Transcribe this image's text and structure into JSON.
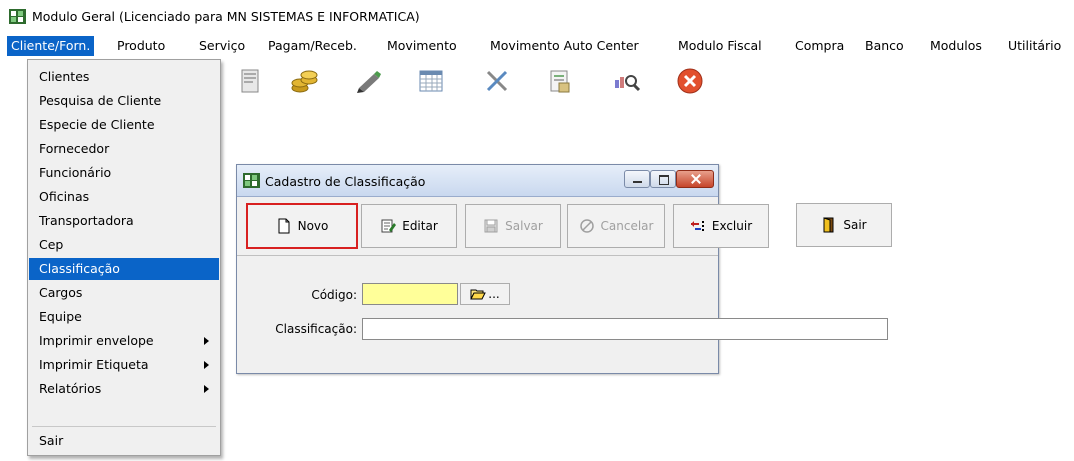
{
  "app": {
    "title": "Modulo Geral (Licenciado para MN SISTEMAS E INFORMATICA)"
  },
  "menu": [
    {
      "label": "Cliente/Forn.",
      "active": true
    },
    {
      "label": "Produto"
    },
    {
      "label": "Serviço"
    },
    {
      "label": "Pagam/Receb."
    },
    {
      "label": "Movimento"
    },
    {
      "label": "Movimento Auto Center"
    },
    {
      "label": "Modulo Fiscal"
    },
    {
      "label": "Compra"
    },
    {
      "label": "Banco"
    },
    {
      "label": "Modulos"
    },
    {
      "label": "Utilitário"
    }
  ],
  "toolbar_icons": [
    "document-icon",
    "coins-icon",
    "pen-icon",
    "calendar-icon",
    "tools-icon",
    "report-icon",
    "magnifier-icon",
    "close-circle-icon"
  ],
  "dropdown": {
    "items": [
      {
        "label": "Clientes"
      },
      {
        "label": "Pesquisa de Cliente"
      },
      {
        "label": "Especie de Cliente"
      },
      {
        "label": "Fornecedor"
      },
      {
        "label": "Funcionário"
      },
      {
        "label": "Oficinas"
      },
      {
        "label": "Transportadora"
      },
      {
        "label": "Cep"
      },
      {
        "label": "Classificação",
        "selected": true
      },
      {
        "label": "Cargos"
      },
      {
        "label": "Equipe"
      },
      {
        "label": "Imprimir envelope",
        "submenu": true
      },
      {
        "label": "Imprimir Etiqueta",
        "submenu": true
      },
      {
        "label": "Relatórios",
        "submenu": true
      }
    ],
    "exit_label": "Sair"
  },
  "dialog": {
    "title": "Cadastro de Classificação",
    "buttons": {
      "novo": "Novo",
      "editar": "Editar",
      "salvar": "Salvar",
      "cancelar": "Cancelar",
      "excluir": "Excluir",
      "sair": "Sair"
    },
    "fields": {
      "codigo_label": "Código:",
      "codigo_value": "",
      "browse_label": "...",
      "classificacao_label": "Classificação:",
      "classificacao_value": ""
    }
  },
  "colors": {
    "menu_highlight": "#0a64c8",
    "input_focus": "#ffff99",
    "highlight_box": "#d82020"
  }
}
